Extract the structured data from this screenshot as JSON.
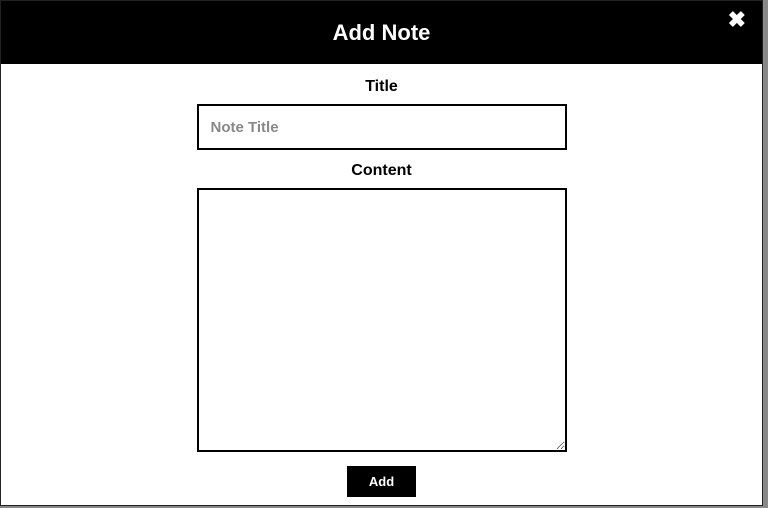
{
  "modal": {
    "title": "Add Note",
    "close_glyph": "✖",
    "fields": {
      "title_label": "Title",
      "title_placeholder": "Note Title",
      "title_value": "",
      "content_label": "Content",
      "content_value": ""
    },
    "add_button_label": "Add"
  }
}
